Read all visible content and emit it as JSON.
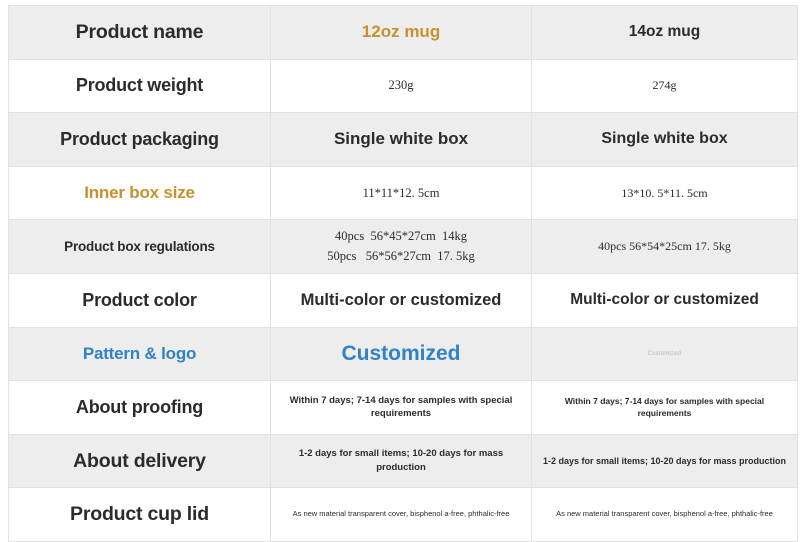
{
  "table": {
    "columns": [
      "",
      "12oz mug",
      "14oz mug"
    ],
    "rows": [
      {
        "label": "Product name",
        "col_a": "12oz mug",
        "col_b": "14oz mug"
      },
      {
        "label": "Product weight",
        "col_a": "230g",
        "col_b": "274g"
      },
      {
        "label": "Product packaging",
        "col_a": "Single white box",
        "col_b": "Single white box"
      },
      {
        "label": "Inner box size",
        "col_a": "11*11*12. 5cm",
        "col_b": "13*10. 5*11. 5cm"
      },
      {
        "label": "Product box regulations",
        "col_a_line1": "40pcs  56*45*27cm  14kg",
        "col_a_line2": "50pcs   56*56*27cm  17. 5kg",
        "col_b": "40pcs  56*54*25cm   17. 5kg"
      },
      {
        "label": "Product color",
        "col_a": "Multi-color or customized",
        "col_b": "Multi-color or customized"
      },
      {
        "label": "Pattern & logo",
        "col_a": "Customized",
        "col_b": "Customized"
      },
      {
        "label": "About proofing",
        "col_a": "Within 7 days; 7-14 days for samples with special requirements",
        "col_b": "Within 7 days; 7-14 days for samples with special requirements"
      },
      {
        "label": "About delivery",
        "col_a": "1-2 days for small items; 10-20 days for mass production",
        "col_b": "1-2 days for small items; 10-20 days for mass production"
      },
      {
        "label": "Product cup lid",
        "col_a": "As new material transparent cover, bisphenol a-free, phthalic-free",
        "col_b": "As new material transparent cover, bisphenol a-free, phthalic-free"
      }
    ]
  },
  "colors": {
    "accent_gold": "#c8912e",
    "accent_blue": "#3182c8",
    "row_gray": "#ededed",
    "row_white": "#ffffff",
    "border": "#e2e2e2",
    "text_dark": "#2b2b2b",
    "text_faint": "#b9b9b9"
  }
}
